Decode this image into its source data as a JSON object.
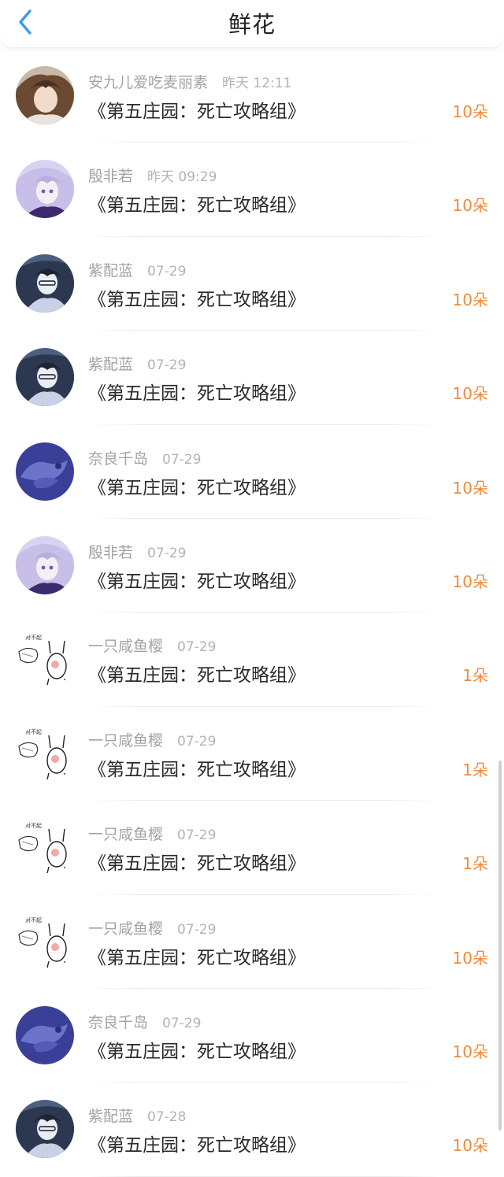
{
  "header": {
    "title": "鲜花",
    "back_icon": "chevron-left-icon",
    "accent_color": "#3a9bf0"
  },
  "colors": {
    "amount": "#f08a3c",
    "meta": "#a3a3a3",
    "work": "#2a2a2a"
  },
  "items": [
    {
      "name": "安九儿爱吃麦丽素",
      "time": "昨天 12:11",
      "work": "《第五庄园：死亡攻略组》",
      "amount": "10朵",
      "avatar": "avatar-anime-brown"
    },
    {
      "name": "殷非若",
      "time": "昨天 09:29",
      "work": "《第五庄园：死亡攻略组》",
      "amount": "10朵",
      "avatar": "avatar-anime-lavender"
    },
    {
      "name": "紫配蓝",
      "time": "07-29",
      "work": "《第五庄园：死亡攻略组》",
      "amount": "10朵",
      "avatar": "avatar-anime-dark"
    },
    {
      "name": "紫配蓝",
      "time": "07-29",
      "work": "《第五庄园：死亡攻略组》",
      "amount": "10朵",
      "avatar": "avatar-anime-dark"
    },
    {
      "name": "奈良千岛",
      "time": "07-29",
      "work": "《第五庄园：死亡攻略组》",
      "amount": "10朵",
      "avatar": "avatar-blue"
    },
    {
      "name": "殷非若",
      "time": "07-29",
      "work": "《第五庄园：死亡攻略组》",
      "amount": "10朵",
      "avatar": "avatar-anime-lavender"
    },
    {
      "name": "一只咸鱼樱",
      "time": "07-29",
      "work": "《第五庄园：死亡攻略组》",
      "amount": "1朵",
      "avatar": "avatar-sketch"
    },
    {
      "name": "一只咸鱼樱",
      "time": "07-29",
      "work": "《第五庄园：死亡攻略组》",
      "amount": "1朵",
      "avatar": "avatar-sketch"
    },
    {
      "name": "一只咸鱼樱",
      "time": "07-29",
      "work": "《第五庄园：死亡攻略组》",
      "amount": "1朵",
      "avatar": "avatar-sketch"
    },
    {
      "name": "一只咸鱼樱",
      "time": "07-29",
      "work": "《第五庄园：死亡攻略组》",
      "amount": "10朵",
      "avatar": "avatar-sketch"
    },
    {
      "name": "奈良千岛",
      "time": "07-29",
      "work": "《第五庄园：死亡攻略组》",
      "amount": "10朵",
      "avatar": "avatar-blue"
    },
    {
      "name": "紫配蓝",
      "time": "07-28",
      "work": "《第五庄园：死亡攻略组》",
      "amount": "10朵",
      "avatar": "avatar-anime-dark"
    }
  ]
}
